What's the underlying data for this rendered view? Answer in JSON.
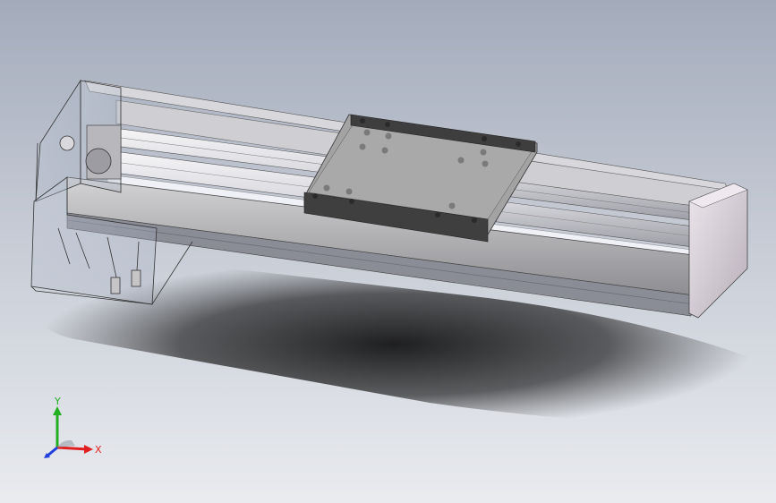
{
  "view": {
    "triad": {
      "x_label": "X",
      "y_label": "Y",
      "z_label": "",
      "x_color": "#e02020",
      "y_color": "#22b022",
      "z_color": "#2040e0"
    },
    "colors": {
      "background_top": "#a3abbb",
      "background_bottom": "#e9ebef",
      "slide_plate": "#a4a4a4",
      "profile_body": "#c9c9c9",
      "rail": "#e8e8ec",
      "end_cap": "#c7bfc8",
      "mount_plate": "#3e3e3e"
    }
  },
  "model": {
    "components": [
      "aluminum-profile-base",
      "linear-guide-rail-upper",
      "linear-guide-rail-lower",
      "slide-carriage-plate",
      "carriage-mount-plate",
      "right-end-cap",
      "motor-housing-transparent",
      "motor-bracket",
      "timing-pulley"
    ]
  }
}
